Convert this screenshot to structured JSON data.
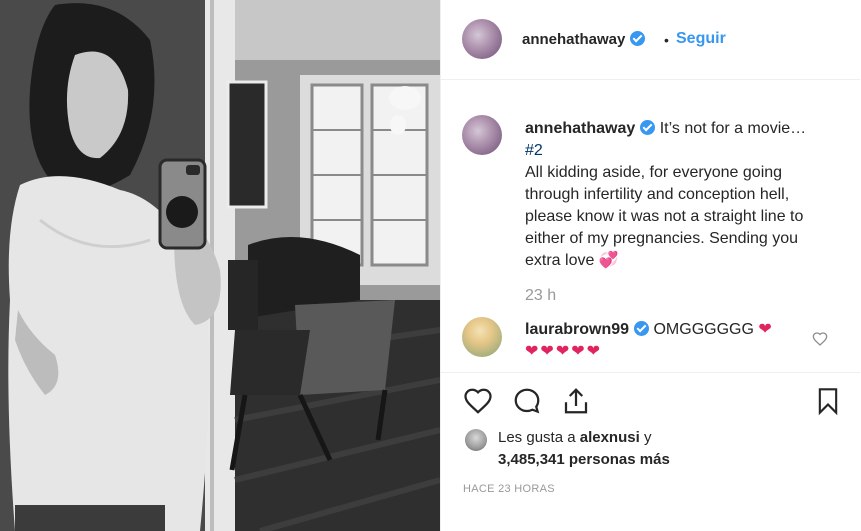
{
  "post": {
    "username": "annehathaway",
    "follow_label": "Seguir",
    "separator": "•"
  },
  "caption": {
    "username": "annehathaway",
    "line_first": "It’s not for a movie…",
    "hashtag": "#2",
    "body": "All kidding aside, for everyone going through infertility and conception hell, please know it was not a straight line to either of my pregnancies. Sending you extra love",
    "emoji": "💞",
    "time": "23 h"
  },
  "comment": {
    "username": "laurabrown99",
    "text": "OMGGGGGG",
    "emoji": "❤",
    "hearts": "❤❤❤❤❤"
  },
  "likes": {
    "prefix": "Les gusta a",
    "user": "alexnusi",
    "conj": "y",
    "count_text": "3,485,341 personas más"
  },
  "timestamp": "HACE 23 HORAS",
  "icons": [
    "verified-icon",
    "heart-icon",
    "comment-icon",
    "share-icon",
    "bookmark-icon"
  ],
  "colors": {
    "link": "#3897f0",
    "verified": "#3897f0",
    "heart": "#e0245e",
    "muted": "#999999"
  }
}
